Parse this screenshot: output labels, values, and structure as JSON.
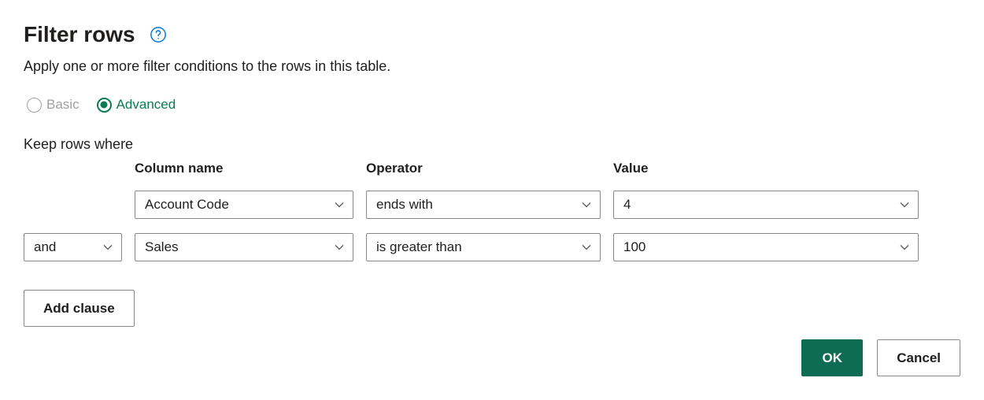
{
  "header": {
    "title": "Filter rows",
    "subheading": "Apply one or more filter conditions to the rows in this table."
  },
  "mode": {
    "basic_label": "Basic",
    "advanced_label": "Advanced",
    "selected": "advanced"
  },
  "keep_label": "Keep rows where",
  "columns": {
    "column_name": "Column name",
    "operator": "Operator",
    "value": "Value"
  },
  "clauses": [
    {
      "logic": "",
      "column": "Account Code",
      "operator": "ends with",
      "value": "4"
    },
    {
      "logic": "and",
      "column": "Sales",
      "operator": "is greater than",
      "value": "100"
    }
  ],
  "buttons": {
    "add_clause": "Add clause",
    "ok": "OK",
    "cancel": "Cancel"
  }
}
